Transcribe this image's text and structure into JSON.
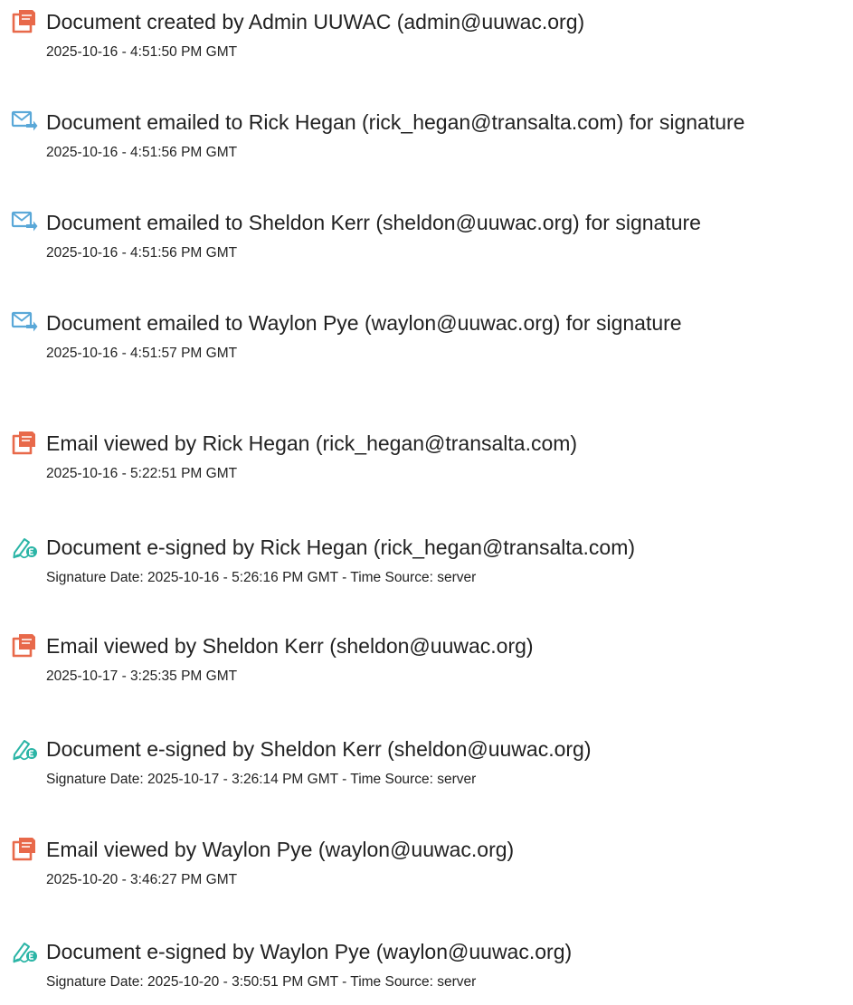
{
  "colors": {
    "created_icon": "#e8694a",
    "emailed_icon": "#5aa8d8",
    "signed_icon": "#2bb5a6",
    "text": "#222222"
  },
  "events": [
    {
      "icon": "document-icon",
      "text": "Document created by Admin UUWAC (admin@uuwac.org)",
      "meta": "2025-10-16 - 4:51:50 PM GMT"
    },
    {
      "icon": "email-send-icon",
      "text": "Document emailed to Rick Hegan (rick_hegan@transalta.com) for signature",
      "meta": "2025-10-16 - 4:51:56 PM GMT"
    },
    {
      "icon": "email-send-icon",
      "text": "Document emailed to Sheldon Kerr (sheldon@uuwac.org) for signature",
      "meta": "2025-10-16 - 4:51:56 PM GMT"
    },
    {
      "icon": "email-send-icon",
      "text": "Document emailed to Waylon Pye (waylon@uuwac.org) for signature",
      "meta": "2025-10-16 - 4:51:57 PM GMT"
    },
    {
      "icon": "document-icon",
      "text": "Email viewed by Rick Hegan (rick_hegan@transalta.com)",
      "meta": "2025-10-16 - 5:22:51 PM GMT"
    },
    {
      "icon": "e-sign-pen-icon",
      "text": "Document e-signed by Rick Hegan (rick_hegan@transalta.com)",
      "meta": "Signature Date: 2025-10-16 - 5:26:16 PM GMT - Time Source: server"
    },
    {
      "icon": "document-icon",
      "text": "Email viewed by Sheldon Kerr (sheldon@uuwac.org)",
      "meta": "2025-10-17 - 3:25:35 PM GMT"
    },
    {
      "icon": "e-sign-pen-icon",
      "text": "Document e-signed by Sheldon Kerr (sheldon@uuwac.org)",
      "meta": "Signature Date: 2025-10-17 - 3:26:14 PM GMT - Time Source: server"
    },
    {
      "icon": "document-icon",
      "text": "Email viewed by Waylon Pye (waylon@uuwac.org)",
      "meta": "2025-10-20 - 3:46:27 PM GMT"
    },
    {
      "icon": "e-sign-pen-icon",
      "text": "Document e-signed by Waylon Pye (waylon@uuwac.org)",
      "meta": "Signature Date: 2025-10-20 - 3:50:51 PM GMT - Time Source: server"
    }
  ]
}
